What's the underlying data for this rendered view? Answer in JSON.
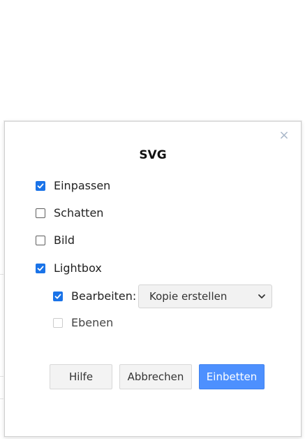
{
  "dialog": {
    "title": "SVG",
    "close_icon": "close-icon",
    "options": {
      "fit": {
        "label": "Einpassen",
        "checked": true
      },
      "shadow": {
        "label": "Schatten",
        "checked": false
      },
      "image": {
        "label": "Bild",
        "checked": false
      },
      "lightbox": {
        "label": "Lightbox",
        "checked": true
      },
      "edit": {
        "label": "Bearbeiten:",
        "checked": true
      },
      "layers": {
        "label": "Ebenen",
        "checked": false,
        "disabled": true
      }
    },
    "edit_select": {
      "selected": "Kopie erstellen"
    },
    "buttons": {
      "help": "Hilfe",
      "cancel": "Abbrechen",
      "embed": "Einbetten"
    }
  },
  "colors": {
    "accent": "#1a73e8",
    "primary_button": "#4d90fe"
  }
}
